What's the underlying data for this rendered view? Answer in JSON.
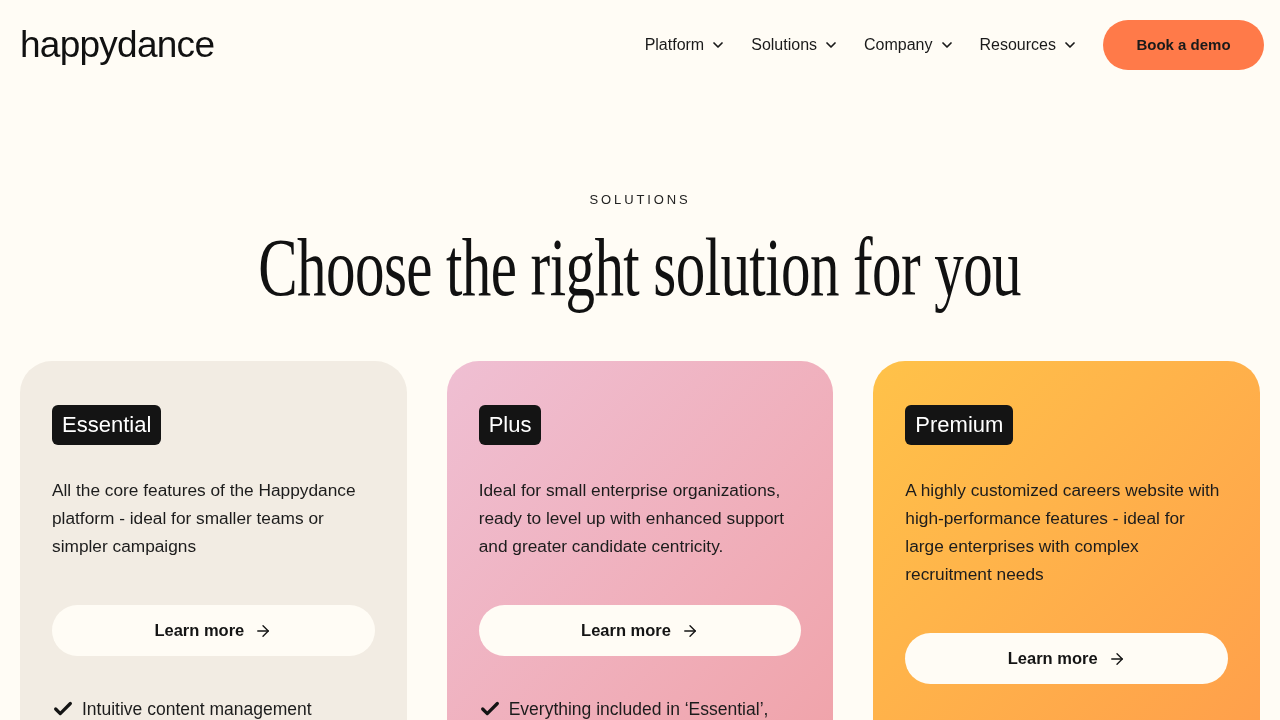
{
  "header": {
    "logo": "happydance",
    "nav": [
      "Platform",
      "Solutions",
      "Company",
      "Resources"
    ],
    "cta": "Book a demo"
  },
  "hero": {
    "eyebrow": "SOLUTIONS",
    "title": "Choose the right solution for you"
  },
  "cards": [
    {
      "name": "Essential",
      "description": "All the core features of the Happydance platform - ideal for smaller teams or simpler campaigns",
      "button": "Learn more",
      "features": [
        "Intuitive content management"
      ]
    },
    {
      "name": "Plus",
      "description": "Ideal for small enterprise organizations, ready to level up with enhanced support and greater candidate centricity.",
      "button": "Learn more",
      "features": [
        "Everything included in ‘Essential’,"
      ]
    },
    {
      "name": "Premium",
      "description": "A highly customized careers website with high-performance features - ideal for large enterprises with complex recruitment needs",
      "button": "Learn more"
    }
  ]
}
